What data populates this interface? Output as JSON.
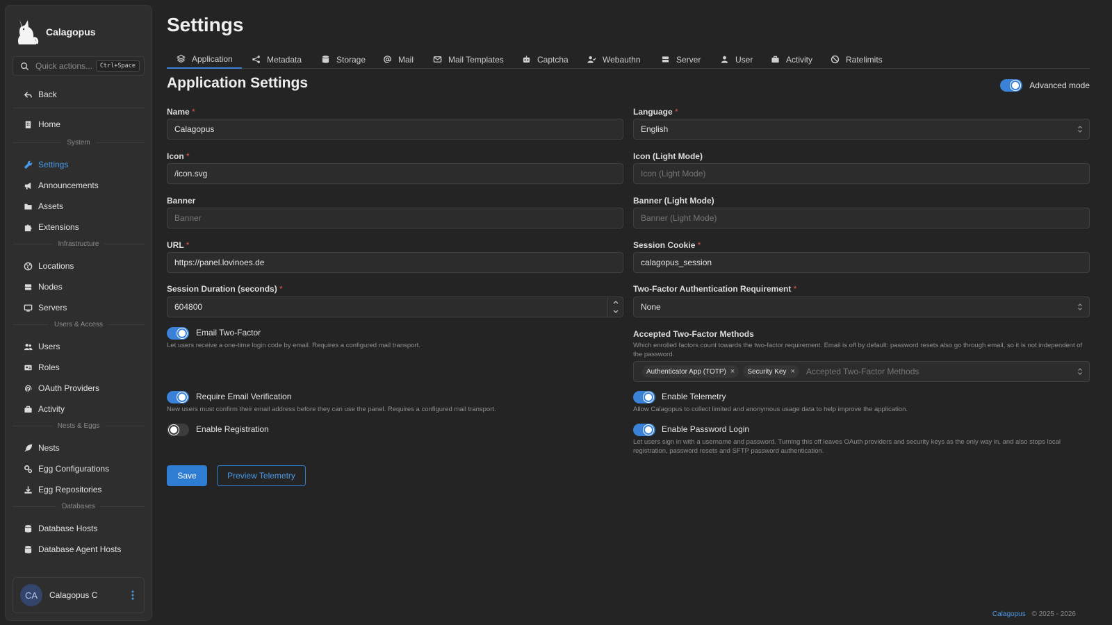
{
  "app": {
    "name": "Calagopus",
    "quick_placeholder": "Quick actions...",
    "quick_shortcut": "Ctrl+Space"
  },
  "sidebar": {
    "back": "Back",
    "home": "Home",
    "groups": {
      "system": "System",
      "infrastructure": "Infrastructure",
      "users": "Users & Access",
      "nests": "Nests & Eggs",
      "databases": "Databases"
    },
    "items": {
      "settings": "Settings",
      "announcements": "Announcements",
      "assets": "Assets",
      "extensions": "Extensions",
      "locations": "Locations",
      "nodes": "Nodes",
      "servers": "Servers",
      "users": "Users",
      "roles": "Roles",
      "oauth": "OAuth Providers",
      "activity": "Activity",
      "nests": "Nests",
      "egg_configs": "Egg Configurations",
      "egg_repos": "Egg Repositories",
      "db_hosts": "Database Hosts",
      "db_agent_hosts": "Database Agent Hosts"
    },
    "user": {
      "initials": "CA",
      "name": "Calagopus C"
    }
  },
  "header": {
    "title": "Settings"
  },
  "tabs": [
    "Application",
    "Metadata",
    "Storage",
    "Mail",
    "Mail Templates",
    "Captcha",
    "Webauthn",
    "Server",
    "User",
    "Activity",
    "Ratelimits"
  ],
  "section": {
    "title": "Application Settings",
    "advanced_mode": "Advanced mode",
    "advanced_mode_on": true
  },
  "form": {
    "name": {
      "label": "Name",
      "value": "Calagopus"
    },
    "language": {
      "label": "Language",
      "value": "English"
    },
    "icon": {
      "label": "Icon",
      "value": "/icon.svg"
    },
    "icon_light": {
      "label": "Icon (Light Mode)",
      "placeholder": "Icon (Light Mode)"
    },
    "banner": {
      "label": "Banner",
      "placeholder": "Banner"
    },
    "banner_light": {
      "label": "Banner (Light Mode)",
      "placeholder": "Banner (Light Mode)"
    },
    "url": {
      "label": "URL",
      "value": "https://panel.lovinoes.de"
    },
    "session_cookie": {
      "label": "Session Cookie",
      "value": "calagopus_session"
    },
    "session_duration": {
      "label": "Session Duration (seconds)",
      "value": "604800"
    },
    "two_factor_req": {
      "label": "Two-Factor Authentication Requirement",
      "value": "None"
    },
    "accepted_methods": {
      "label": "Accepted Two-Factor Methods",
      "description": "Which enrolled factors count towards the two-factor requirement. Email is off by default: password resets also go through email, so it is not independent of the password.",
      "chips": [
        "Authenticator App (TOTP)",
        "Security Key"
      ],
      "placeholder": "Accepted Two-Factor Methods"
    },
    "email_two_factor": {
      "label": "Email Two-Factor",
      "enabled": true,
      "description": "Let users receive a one-time login code by email. Requires a configured mail transport."
    },
    "require_email_verification": {
      "label": "Require Email Verification",
      "enabled": true,
      "description": "New users must confirm their email address before they can use the panel. Requires a configured mail transport."
    },
    "enable_registration": {
      "label": "Enable Registration",
      "enabled": false
    },
    "enable_telemetry": {
      "label": "Enable Telemetry",
      "enabled": true,
      "description": "Allow Calagopus to collect limited and anonymous usage data to help improve the application."
    },
    "enable_password_login": {
      "label": "Enable Password Login",
      "enabled": true,
      "description": "Let users sign in with a username and password. Turning this off leaves OAuth providers and security keys as the only way in, and also stops local registration, password resets and SFTP password authentication."
    }
  },
  "actions": {
    "save": "Save",
    "preview_telemetry": "Preview Telemetry"
  },
  "footer": {
    "brand": "Calagopus",
    "copyright": "© 2025 - 2026"
  },
  "colors": {
    "accent": "#3a82d8",
    "background": "#242424",
    "sidebar": "#2e2e2e",
    "required": "#e05656"
  }
}
